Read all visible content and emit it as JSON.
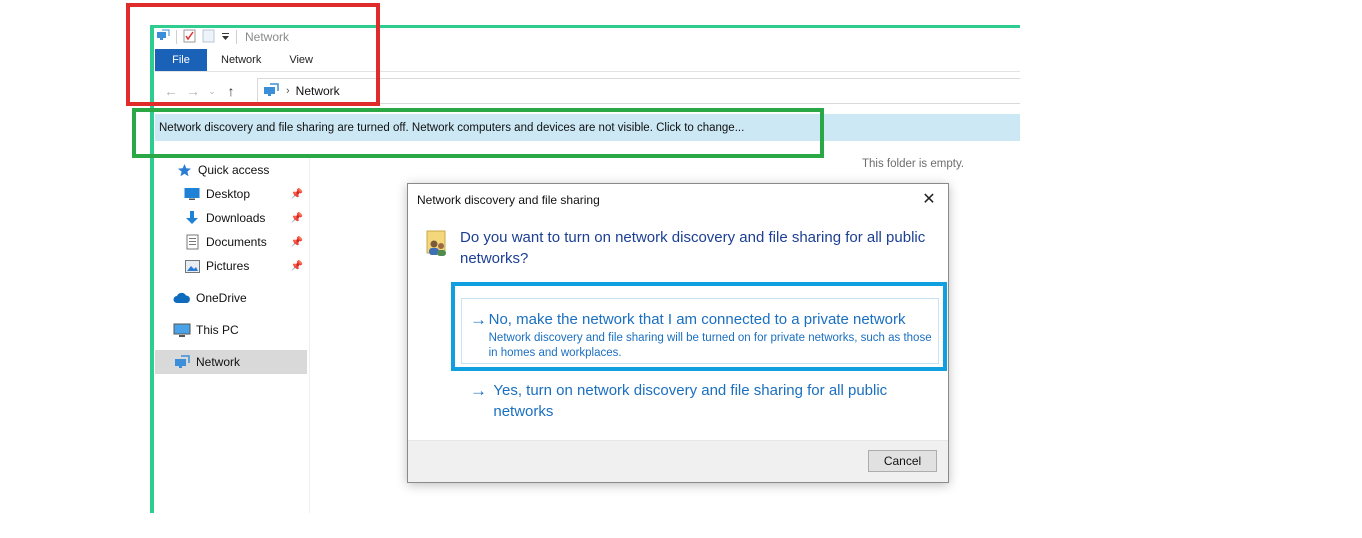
{
  "window": {
    "title": "Network"
  },
  "ribbon": {
    "tabs": [
      {
        "label": "File"
      },
      {
        "label": "Network"
      },
      {
        "label": "View"
      }
    ]
  },
  "address_bar": {
    "path": [
      "Network"
    ]
  },
  "info_bar": {
    "text": "Network discovery and file sharing are turned off. Network computers and devices are not visible. Click to change..."
  },
  "nav_pane": {
    "items": [
      {
        "label": "Quick access",
        "icon": "star-icon"
      },
      {
        "label": "Desktop",
        "icon": "desktop-icon",
        "pinned": true
      },
      {
        "label": "Downloads",
        "icon": "download-arrow-icon",
        "pinned": true
      },
      {
        "label": "Documents",
        "icon": "document-icon",
        "pinned": true
      },
      {
        "label": "Pictures",
        "icon": "pictures-icon",
        "pinned": true
      },
      {
        "label": "OneDrive",
        "icon": "cloud-icon"
      },
      {
        "label": "This PC",
        "icon": "computer-icon"
      },
      {
        "label": "Network",
        "icon": "network-icon",
        "selected": true
      }
    ]
  },
  "content": {
    "empty_message": "This folder is empty."
  },
  "dialog": {
    "title": "Network discovery and file sharing",
    "question": "Do you want to turn on network discovery and file sharing for all public networks?",
    "options": [
      {
        "main": "No, make the network that I am connected to a private network",
        "sub": "Network discovery and file sharing will be turned on for private networks, such as those in homes and workplaces."
      },
      {
        "main": "Yes, turn on network discovery and file sharing for all public networks",
        "sub": ""
      }
    ],
    "cancel_label": "Cancel"
  },
  "colors": {
    "annotation_red": "#e02b2b",
    "annotation_green": "#29a845",
    "annotation_blue": "#10a0e0",
    "annotation_teal": "#2ecc8e",
    "file_tab": "#1a62b8",
    "info_bar_bg": "#cce8f4",
    "link_blue": "#1a6fc0"
  }
}
